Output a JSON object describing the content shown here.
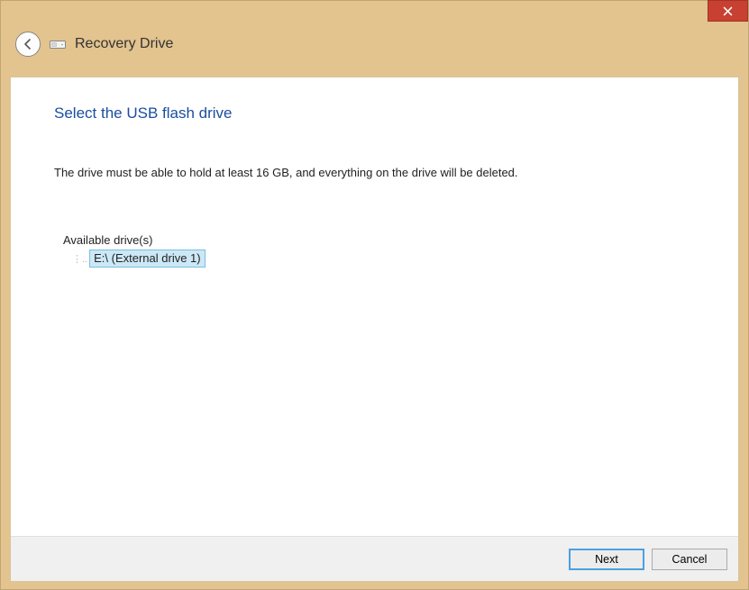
{
  "window": {
    "wizard_title": "Recovery Drive"
  },
  "page": {
    "heading": "Select the USB flash drive",
    "instruction": "The drive must be able to hold at least 16 GB, and everything on the drive will be deleted.",
    "available_label": "Available drive(s)"
  },
  "drives": [
    {
      "label": "E:\\ (External drive 1)"
    }
  ],
  "buttons": {
    "next": "Next",
    "cancel": "Cancel"
  }
}
